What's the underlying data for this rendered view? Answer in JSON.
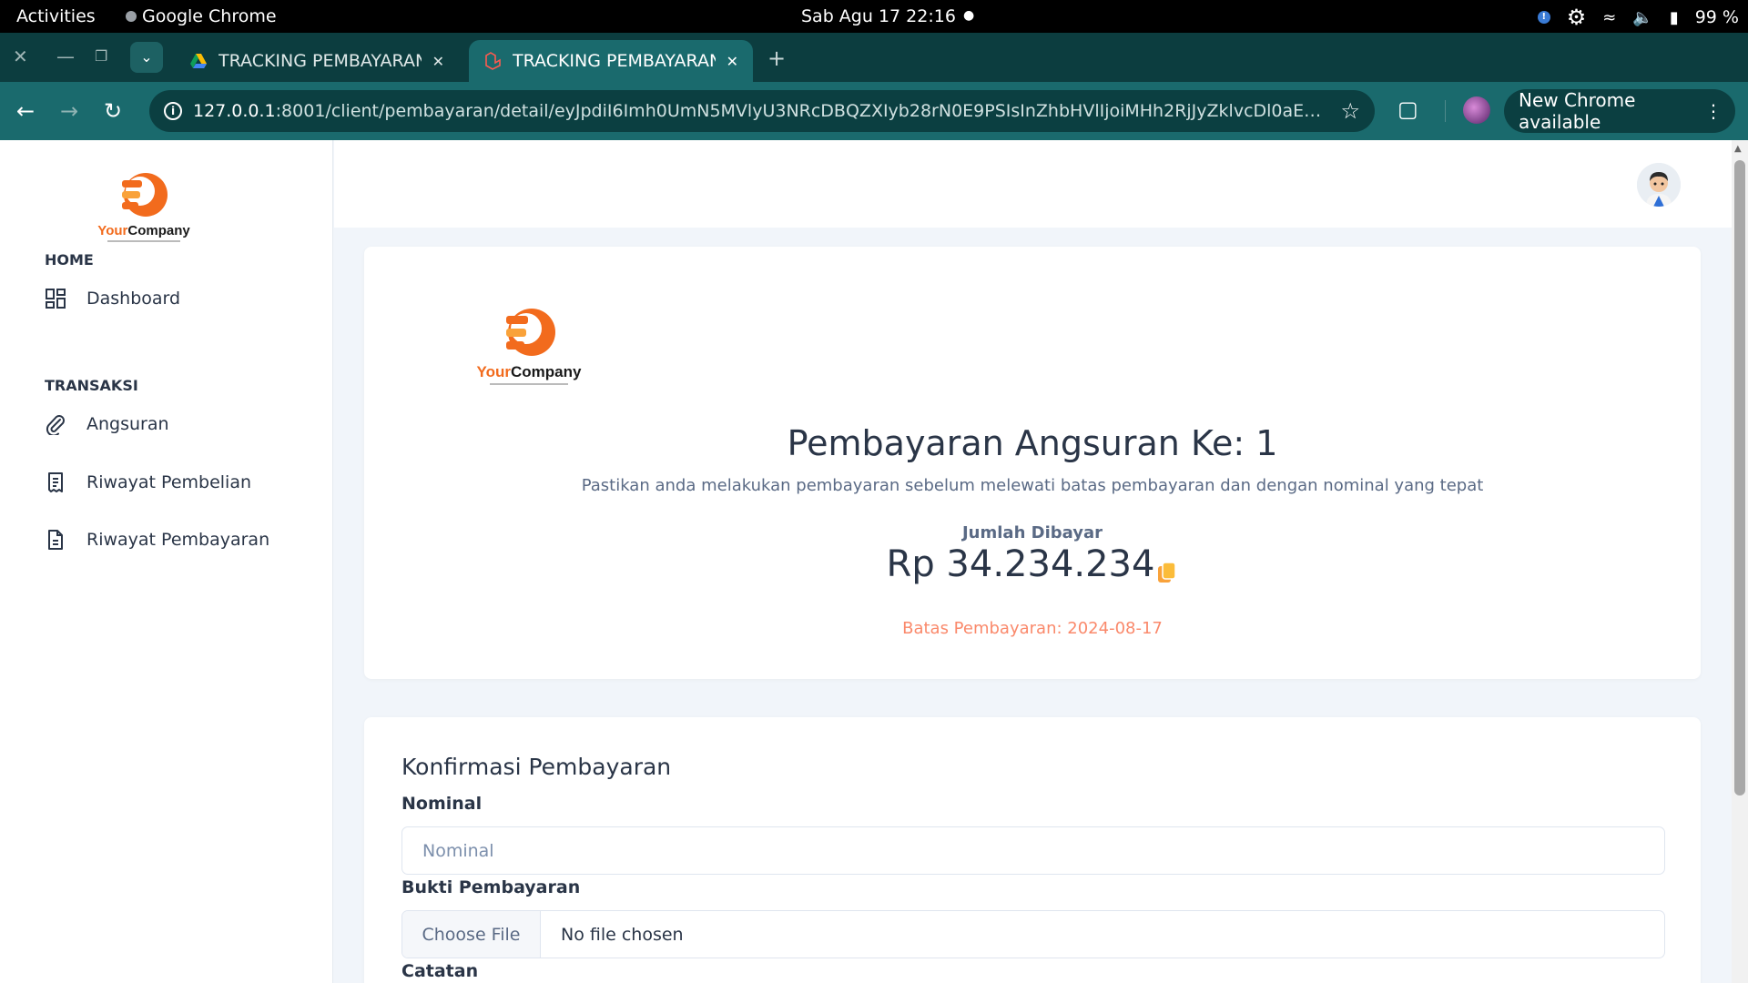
{
  "os_bar": {
    "activities": "Activities",
    "app_name": "Google Chrome",
    "clock": "Sab Agu 17  22:16",
    "battery": "99 %"
  },
  "browser": {
    "tabs": [
      {
        "title": "TRACKING PEMBAYARAN",
        "active": false,
        "favicon": "google-drive-icon"
      },
      {
        "title": "TRACKING PEMBAYARAN",
        "active": true,
        "favicon": "laravel-icon"
      }
    ],
    "url_host": "127.0.0.1",
    "url_rest": ":8001/client/pembayaran/detail/eyJpdiI6Imh0UmN5MVlyU3NRcDBQZXIyb28rN0E9PSIsInZhbHVlIjoiMHh2RjJyZklvcDl0aEY0QXRpbFF...",
    "update_label": "New Chrome available"
  },
  "sidebar": {
    "logo_text": "YourCompany",
    "sections": [
      {
        "heading": "HOME",
        "items": [
          {
            "label": "Dashboard",
            "icon": "dashboard-icon"
          }
        ]
      },
      {
        "heading": "TRANSAKSI",
        "items": [
          {
            "label": "Angsuran",
            "icon": "paperclip-icon"
          },
          {
            "label": "Riwayat Pembelian",
            "icon": "receipt-icon"
          },
          {
            "label": "Riwayat Pembayaran",
            "icon": "file-text-icon"
          }
        ]
      }
    ]
  },
  "payment": {
    "logo_text": "YourCompany",
    "title": "Pembayaran Angsuran Ke: 1",
    "subtitle": "Pastikan anda melakukan pembayaran sebelum melewati batas pembayaran dan dengan nominal yang tepat",
    "amount_label": "Jumlah Dibayar",
    "amount": "Rp 34.234.234",
    "deadline": "Batas Pembayaran: 2024-08-17"
  },
  "confirm": {
    "title": "Konfirmasi Pembayaran",
    "nominal_label": "Nominal",
    "nominal_placeholder": "Nominal",
    "proof_label": "Bukti Pembayaran",
    "choose_file": "Choose File",
    "no_file": "No file chosen",
    "notes_label": "Catatan"
  },
  "colors": {
    "accent_teal": "#1a6a6d",
    "deadline": "#fa896b",
    "logo_orange": "#f26b1d"
  }
}
